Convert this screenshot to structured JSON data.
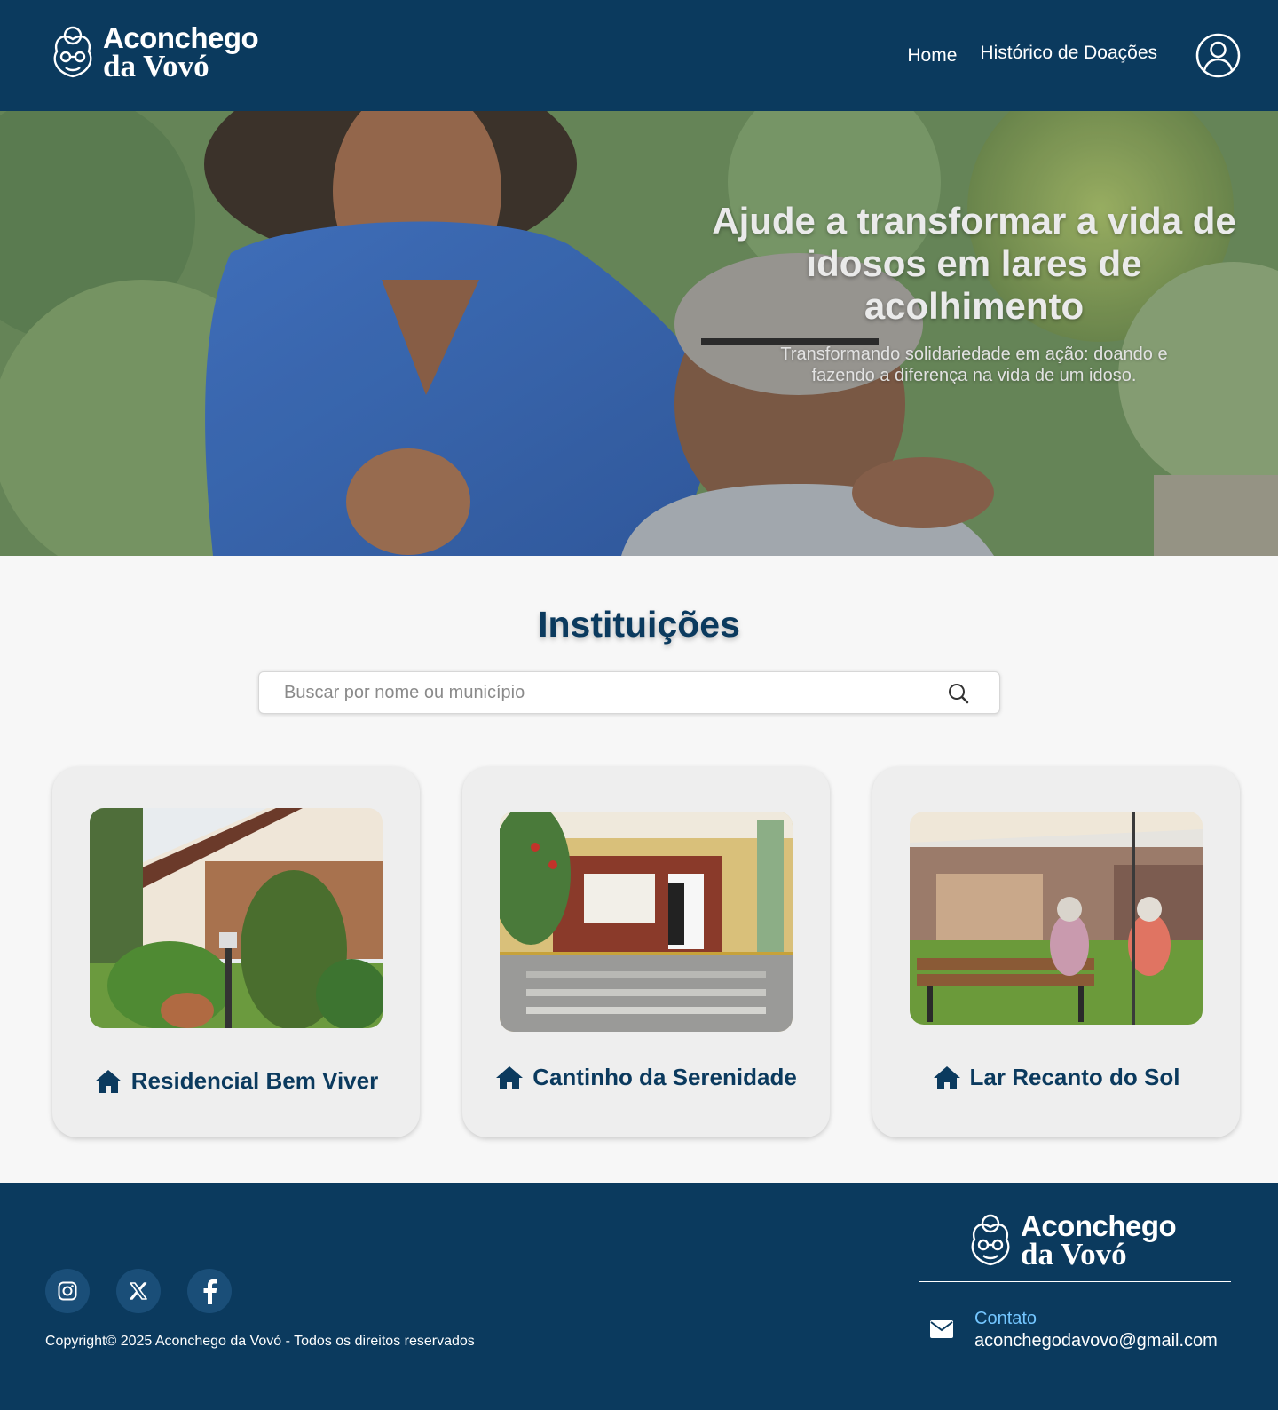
{
  "brand": {
    "line1": "Aconchego",
    "line2": "da Vovó"
  },
  "nav": {
    "home": "Home",
    "history": "Histórico de Doações"
  },
  "icons": {
    "user": "user-circle-icon",
    "search": "search-icon",
    "house": "house-icon",
    "mail": "envelope-icon",
    "instagram": "instagram-icon",
    "x": "x-icon",
    "facebook": "facebook-icon"
  },
  "colors": {
    "primary": "#0b3a5e",
    "contact_label": "#74c6ff",
    "background": "#f7f7f7",
    "card": "#eeeeee"
  },
  "hero": {
    "title": "Ajude a transformar a vida de idosos em lares de acolhimento",
    "subtitle": "Transformando solidariedade em ação: doando e fazendo a diferença na vida de um idoso."
  },
  "institutions": {
    "title": "Instituições",
    "search_placeholder": "Buscar por nome ou município",
    "items": [
      {
        "name": "Residencial Bem Viver"
      },
      {
        "name": "Cantinho da Serenidade"
      },
      {
        "name": "Lar Recanto do Sol"
      }
    ]
  },
  "footer": {
    "copyright": "Copyright© 2025 Aconchego da Vovó - Todos os direitos reservados",
    "contact_label": "Contato",
    "contact_email": "aconchegodavovo@gmail.com"
  }
}
